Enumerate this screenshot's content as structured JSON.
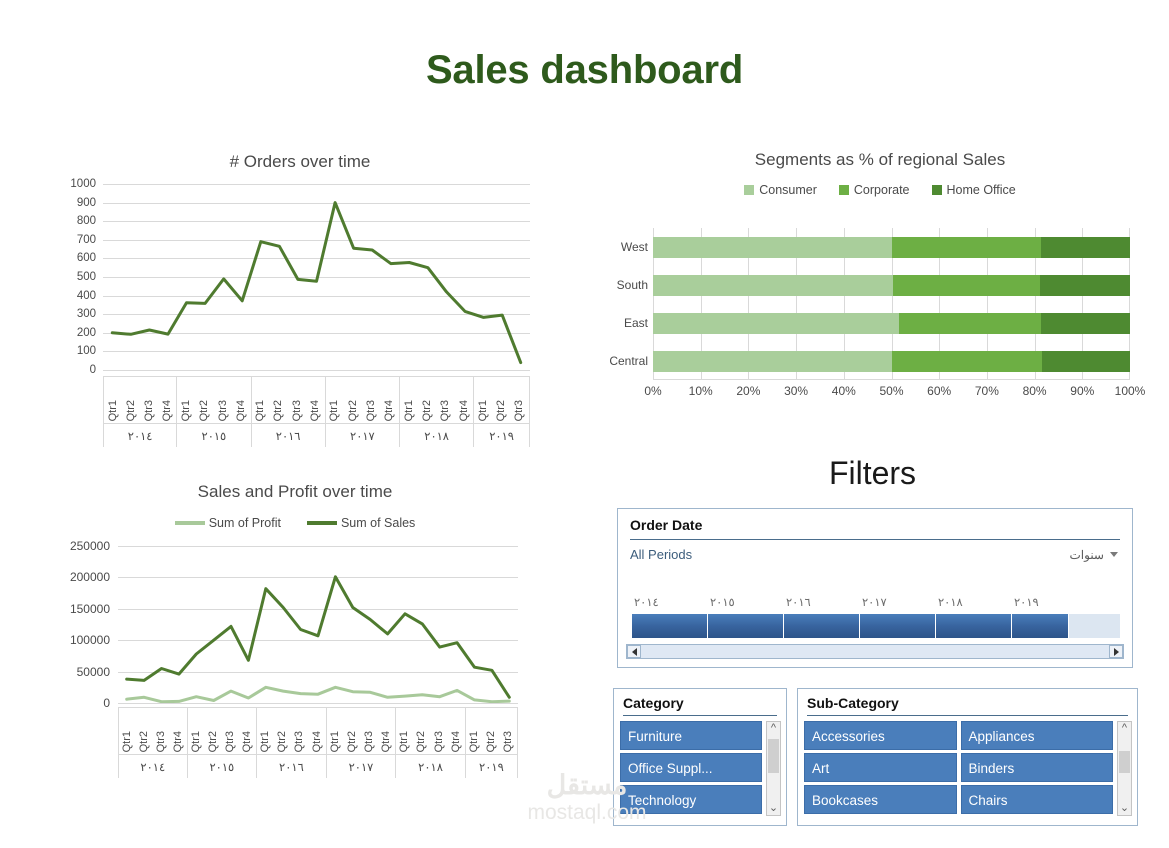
{
  "page": {
    "title": "Sales dashboard",
    "filters_title": "Filters",
    "watermark_ar": "مستقل",
    "watermark_en": "mostaql.com"
  },
  "colors": {
    "title_green": "#2E5A1C",
    "sales_line": "#4F7B2F",
    "profit_line": "#A8C99A",
    "consumer": "#A9CE9B",
    "corporate": "#6DAF44",
    "home_office": "#4E8A31",
    "slicer_blue": "#4A7EBB",
    "grid": "#D9D9D9"
  },
  "chart_data": [
    {
      "id": "orders-over-time",
      "type": "line",
      "title": "# Orders over time",
      "xlabel": "",
      "ylabel": "",
      "ylim": [
        0,
        1000
      ],
      "yticks": [
        0,
        100,
        200,
        300,
        400,
        500,
        600,
        700,
        800,
        900,
        1000
      ],
      "grid": true,
      "legend": "none",
      "years": [
        "٢٠١٤",
        "٢٠١٥",
        "٢٠١٦",
        "٢٠١٧",
        "٢٠١٨",
        "٢٠١٩"
      ],
      "quarters_per_year": [
        4,
        4,
        4,
        4,
        4,
        3
      ],
      "quarter_labels": [
        "Qtr1",
        "Qtr2",
        "Qtr3",
        "Qtr4"
      ],
      "categories": [
        "٢٠١٤ Qtr1",
        "٢٠١٤ Qtr2",
        "٢٠١٤ Qtr3",
        "٢٠١٤ Qtr4",
        "٢٠١٥ Qtr1",
        "٢٠١٥ Qtr2",
        "٢٠١٥ Qtr3",
        "٢٠١٥ Qtr4",
        "٢٠١٦ Qtr1",
        "٢٠١٦ Qtr2",
        "٢٠١٦ Qtr3",
        "٢٠١٦ Qtr4",
        "٢٠١٧ Qtr1",
        "٢٠١٧ Qtr2",
        "٢٠١٧ Qtr3",
        "٢٠١٧ Qtr4",
        "٢٠١٨ Qtr1",
        "٢٠١٨ Qtr2",
        "٢٠١٨ Qtr3",
        "٢٠١٨ Qtr4",
        "٢٠١٩ Qtr1",
        "٢٠١٩ Qtr2",
        "٢٠١٩ Qtr3"
      ],
      "values": [
        200,
        192,
        215,
        193,
        362,
        358,
        490,
        372,
        690,
        665,
        487,
        477,
        900,
        655,
        645,
        572,
        578,
        550,
        420,
        315,
        283,
        295,
        40
      ]
    },
    {
      "id": "segments-pct-regional-sales",
      "type": "bar",
      "orientation": "horizontal",
      "stacked": true,
      "stack_mode": "percent",
      "title": "Segments as % of regional Sales",
      "xlabel": "",
      "ylabel": "",
      "xlim": [
        0,
        100
      ],
      "xticks": [
        0,
        10,
        20,
        30,
        40,
        50,
        60,
        70,
        80,
        90,
        100
      ],
      "xtick_labels": [
        "0%",
        "10%",
        "20%",
        "30%",
        "40%",
        "50%",
        "60%",
        "70%",
        "80%",
        "90%",
        "100%"
      ],
      "grid": true,
      "legend_position": "top",
      "categories": [
        "West",
        "South",
        "East",
        "Central"
      ],
      "series": [
        {
          "name": "Consumer",
          "values": [
            50.2,
            50.3,
            51.6,
            50.2
          ]
        },
        {
          "name": "Corporate",
          "values": [
            31.1,
            30.9,
            29.8,
            31.3
          ]
        },
        {
          "name": "Home Office",
          "values": [
            18.7,
            18.8,
            18.6,
            18.5
          ]
        }
      ]
    },
    {
      "id": "sales-and-profit-over-time",
      "type": "line",
      "title": "Sales and Profit over time",
      "xlabel": "",
      "ylabel": "",
      "ylim": [
        0,
        250000
      ],
      "yticks": [
        0,
        50000,
        100000,
        150000,
        200000,
        250000
      ],
      "ytick_labels": [
        "0",
        "50000",
        "100000",
        "150000",
        "200000",
        "250000"
      ],
      "grid": true,
      "legend_position": "top",
      "years": [
        "٢٠١٤",
        "٢٠١٥",
        "٢٠١٦",
        "٢٠١٧",
        "٢٠١٨",
        "٢٠١٩"
      ],
      "quarters_per_year": [
        4,
        4,
        4,
        4,
        4,
        3
      ],
      "quarter_labels": [
        "Qtr1",
        "Qtr2",
        "Qtr3",
        "Qtr4"
      ],
      "categories": [
        "٢٠١٤ Qtr1",
        "٢٠١٤ Qtr2",
        "٢٠١٤ Qtr3",
        "٢٠١٤ Qtr4",
        "٢٠١٥ Qtr1",
        "٢٠١٥ Qtr2",
        "٢٠١٥ Qtr3",
        "٢٠١٥ Qtr4",
        "٢٠١٦ Qtr1",
        "٢٠١٦ Qtr2",
        "٢٠١٦ Qtr3",
        "٢٠١٦ Qtr4",
        "٢٠١٧ Qtr1",
        "٢٠١٧ Qtr2",
        "٢٠١٧ Qtr3",
        "٢٠١٧ Qtr4",
        "٢٠١٨ Qtr1",
        "٢٠١٨ Qtr2",
        "٢٠١٨ Qtr3",
        "٢٠١٨ Qtr4",
        "٢٠١٩ Qtr1",
        "٢٠١٩ Qtr2",
        "٢٠١٩ Qtr3"
      ],
      "series": [
        {
          "name": "Sum of Profit",
          "values": [
            6000,
            9000,
            2000,
            2500,
            10000,
            4000,
            19000,
            8000,
            25000,
            19000,
            15000,
            14000,
            25000,
            18000,
            17000,
            9000,
            11000,
            13000,
            10000,
            20000,
            5000,
            2000,
            3000
          ]
        },
        {
          "name": "Sum of Sales",
          "values": [
            38000,
            36000,
            55000,
            46000,
            78000,
            100000,
            122000,
            68000,
            182000,
            152000,
            117000,
            107000,
            201000,
            152000,
            133000,
            110000,
            142000,
            126000,
            89000,
            96000,
            57000,
            52000,
            9000
          ]
        }
      ]
    }
  ],
  "timeline_slicer": {
    "header": "Order Date",
    "period_label": "All Periods",
    "level_label": "سنوات",
    "years": [
      "٢٠١٤",
      "٢٠١٥",
      "٢٠١٦",
      "٢٠١٧",
      "٢٠١٨",
      "٢٠١٩"
    ]
  },
  "category_slicer": {
    "header": "Category",
    "items": [
      "Furniture",
      "Office Suppl...",
      "Technology"
    ]
  },
  "subcategory_slicer": {
    "header": "Sub-Category",
    "items": [
      "Accessories",
      "Appliances",
      "Art",
      "Binders",
      "Bookcases",
      "Chairs"
    ]
  }
}
